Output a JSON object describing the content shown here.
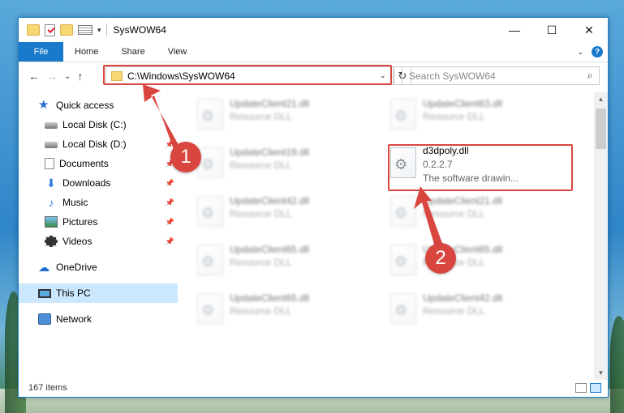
{
  "window": {
    "title": "SysWOW64",
    "minimize": "—",
    "maximize": "☐",
    "close": "✕"
  },
  "ribbon": {
    "tabs": [
      "File",
      "Home",
      "Share",
      "View"
    ],
    "help": "?"
  },
  "nav": {
    "back": "←",
    "forward": "→",
    "recent": "⌄",
    "up": "↑"
  },
  "address": {
    "path": "C:\\Windows\\SysWOW64",
    "refresh": "↻"
  },
  "search": {
    "placeholder": "Search SysWOW64",
    "icon": "⌕"
  },
  "sidebar": {
    "items": [
      {
        "label": "Quick access",
        "icon": "star-icon"
      },
      {
        "label": "Local Disk (C:)",
        "icon": "disk-icon"
      },
      {
        "label": "Local Disk (D:)",
        "icon": "disk-icon"
      },
      {
        "label": "Documents",
        "icon": "document-icon"
      },
      {
        "label": "Downloads",
        "icon": "download-icon"
      },
      {
        "label": "Music",
        "icon": "music-icon"
      },
      {
        "label": "Pictures",
        "icon": "pictures-icon"
      },
      {
        "label": "Videos",
        "icon": "videos-icon"
      },
      {
        "label": "OneDrive",
        "icon": "cloud-icon"
      },
      {
        "label": "This PC",
        "icon": "computer-icon"
      },
      {
        "label": "Network",
        "icon": "network-icon"
      }
    ],
    "pin": "📌"
  },
  "files": [
    {
      "name": "UpdateClient21.dll",
      "type": "Resource DLL"
    },
    {
      "name": "UpdateClient63.dll",
      "type": "Resource DLL"
    },
    {
      "name": "UpdateClient19.dll",
      "type": "Resource DLL"
    },
    {
      "name": "d3dpoly.dll",
      "version": "0.2.2.7",
      "description": "The software drawin..."
    },
    {
      "name": "UpdateClient42.dll",
      "type": "Resource DLL"
    },
    {
      "name": "UpdateClient21.dll",
      "type": "Resource DLL"
    },
    {
      "name": "UpdateClient65.dll",
      "type": "Resource DLL"
    },
    {
      "name": "UpdateClient65.dll",
      "type": "Resource DLL"
    },
    {
      "name": "UpdateClient65.dll",
      "type": "Resource DLL"
    },
    {
      "name": "UpdateClient42.dll",
      "type": "Resource DLL"
    }
  ],
  "status": {
    "count": "167 items"
  },
  "annotations": {
    "step1": "1",
    "step2": "2",
    "accent": "#d9463f"
  },
  "colors": {
    "accent": "#1979ca",
    "selection": "#cce8ff"
  }
}
